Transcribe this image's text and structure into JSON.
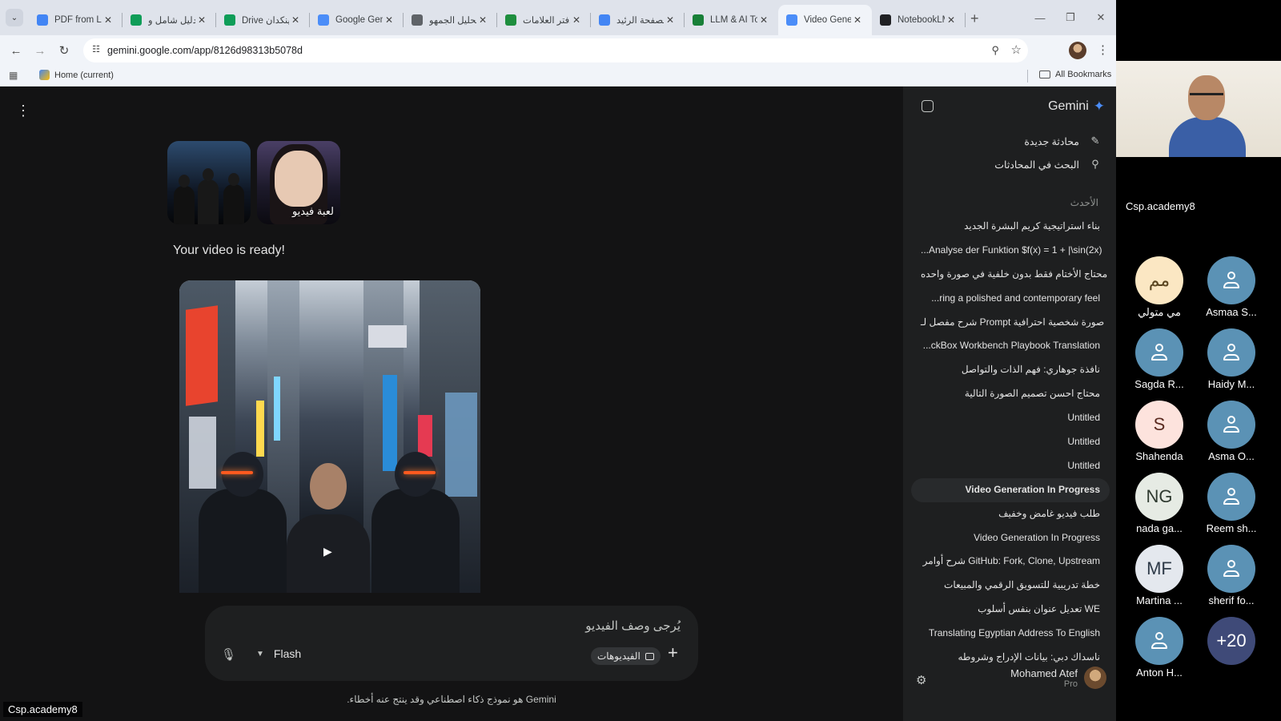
{
  "browser": {
    "tabs": [
      {
        "title": "PDF from Lir",
        "fav_color": "#4285f4",
        "active": false
      },
      {
        "title": "دليل شامل و",
        "fav_color": "#0f9d58",
        "active": false
      },
      {
        "title": "Drive لينكدان",
        "fav_color": "#0f9d58",
        "active": false
      },
      {
        "title": "Google Gem",
        "fav_color": "#4b8df8",
        "active": false
      },
      {
        "title": "تحليل الجمهو",
        "fav_color": "#5f6368",
        "active": false
      },
      {
        "title": "دفتر العلامات",
        "fav_color": "#1e8e3e",
        "active": false
      },
      {
        "title": "الصفحة الرئيد",
        "fav_color": "#4285f4",
        "active": false
      },
      {
        "title": "LLM & AI To",
        "fav_color": "#188038",
        "active": false
      },
      {
        "title": "Video Gener",
        "fav_color": "#4b8df8",
        "active": true
      },
      {
        "title": "NotebookLM",
        "fav_color": "#202124",
        "active": false
      }
    ],
    "tab_close_glyph": "✕",
    "new_tab_glyph": "+",
    "window_controls": {
      "minimize": "—",
      "maximize": "❐",
      "close": "✕"
    },
    "url": "gemini.google.com/app/8126d98313b5078d",
    "bookmarks": {
      "home": "Home (current)",
      "all": "All Bookmarks"
    }
  },
  "chat": {
    "attachment_label": "لعبة فيديو",
    "video_ready": "Your video is ready!",
    "prompt_placeholder": "يُرجى وصف الفيديو",
    "model": "Flash",
    "videos_chip": "الفيديوهات",
    "disclaimer": "Gemini هو نموذج ذكاء اصطناعي وقد ينتج عنه أخطاء."
  },
  "sidebar": {
    "brand": "Gemini",
    "new_chat": "محادثة جديدة",
    "search_chats": "البحث في المحادثات",
    "recent_heading": "الأحدث",
    "items": [
      {
        "label": "بناء استراتيجية كريم البشرة الجديد",
        "active": false
      },
      {
        "label": "...Analyse der Funktion $f(x) = 1 + |\\sin(2x)",
        "active": false
      },
      {
        "label": "محتاج الأختام فقط بدون خلفية في صورة واحده",
        "active": false
      },
      {
        "label": "...ring a polished and contemporary feel",
        "active": false
      },
      {
        "label": "شرح مفصل لـ Prompt صورة شخصية احترافية",
        "active": false
      },
      {
        "label": "...ckBox Workbench Playbook Translation",
        "active": false
      },
      {
        "label": "نافذة جوهاري: فهم الذات والتواصل",
        "active": false
      },
      {
        "label": "محتاج احسن تصميم الصورة التالية",
        "active": false
      },
      {
        "label": "Untitled",
        "active": false
      },
      {
        "label": "Untitled",
        "active": false
      },
      {
        "label": "Untitled",
        "active": false
      },
      {
        "label": "Video Generation In Progress",
        "active": true
      },
      {
        "label": "طلب فيديو غامض وخفيف",
        "active": false
      },
      {
        "label": "Video Generation In Progress",
        "active": false
      },
      {
        "label": "شرح أوامر GitHub: Fork, Clone, Upstream",
        "active": false
      },
      {
        "label": "خطة تدريبية للتسويق الرقمي والمبيعات",
        "active": false
      },
      {
        "label": "تعديل عنوان بنفس أسلوب WE",
        "active": false
      },
      {
        "label": "Translating Egyptian Address To English",
        "active": false
      },
      {
        "label": "ناسداك دبي: بيانات الإدراج وشروطه",
        "active": false
      }
    ],
    "user_name": "Mohamed Atef",
    "user_plan": "Pro"
  },
  "meeting": {
    "cam_name": "Csp.academy8",
    "participants": [
      {
        "name": "مي متولي",
        "initials": "مم",
        "avatar_bg": "#fbe7c3",
        "avatar_fg": "#5a4520",
        "generic": false
      },
      {
        "name": "Asmaa S...",
        "initials": "",
        "avatar_bg": "#5b92b5",
        "avatar_fg": "#ffffff",
        "generic": true
      },
      {
        "name": "Sagda R...",
        "initials": "",
        "avatar_bg": "#5b92b5",
        "avatar_fg": "#ffffff",
        "generic": true
      },
      {
        "name": "Haidy M...",
        "initials": "",
        "avatar_bg": "#5b92b5",
        "avatar_fg": "#ffffff",
        "generic": true
      },
      {
        "name": "Shahenda",
        "initials": "S",
        "avatar_bg": "#fde3dd",
        "avatar_fg": "#5a2a20",
        "generic": false
      },
      {
        "name": "Asma O...",
        "initials": "",
        "avatar_bg": "#5b92b5",
        "avatar_fg": "#ffffff",
        "generic": true
      },
      {
        "name": "nada ga...",
        "initials": "NG",
        "avatar_bg": "#e6ebe4",
        "avatar_fg": "#2f3a30",
        "generic": false
      },
      {
        "name": "Reem sh...",
        "initials": "",
        "avatar_bg": "#5b92b5",
        "avatar_fg": "#ffffff",
        "generic": true
      },
      {
        "name": "Martina ...",
        "initials": "MF",
        "avatar_bg": "#e4e8ee",
        "avatar_fg": "#2e3a48",
        "generic": false
      },
      {
        "name": "sherif fo...",
        "initials": "",
        "avatar_bg": "#5b92b5",
        "avatar_fg": "#ffffff",
        "generic": true
      },
      {
        "name": "Anton H...",
        "initials": "",
        "avatar_bg": "#5b92b5",
        "avatar_fg": "#ffffff",
        "generic": true
      },
      {
        "name": "",
        "initials": "+20",
        "avatar_bg": "#3f4a78",
        "avatar_fg": "#ffffff",
        "generic": false
      }
    ],
    "bottom_label": "Csp.academy8"
  }
}
